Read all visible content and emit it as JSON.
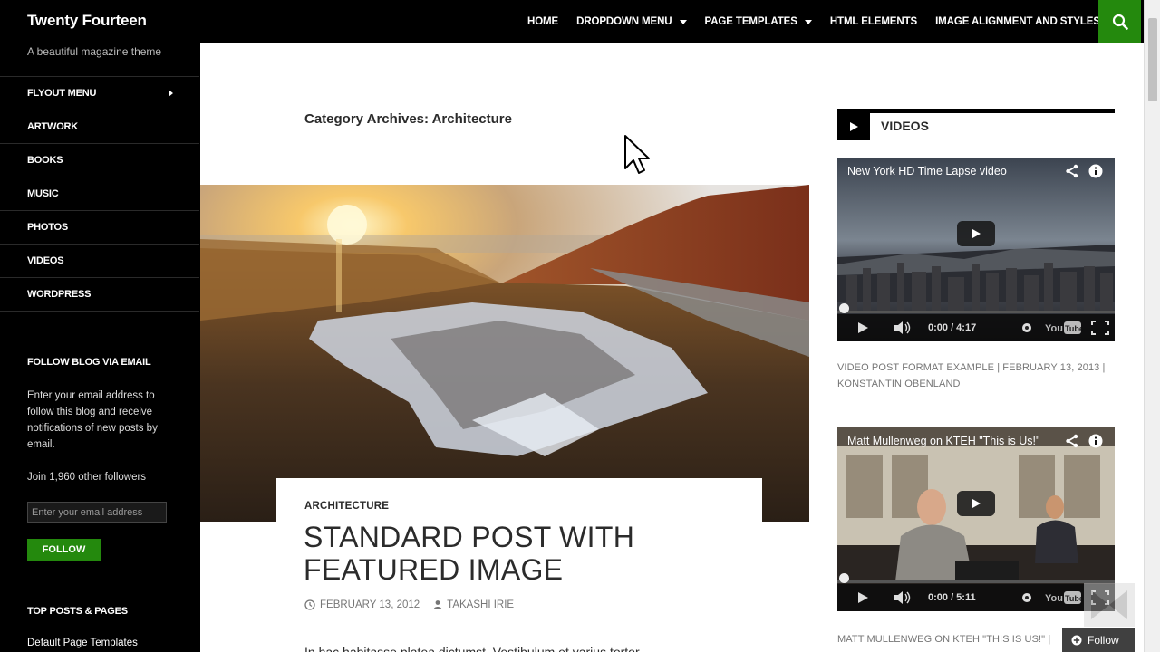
{
  "site": {
    "title": "Twenty Fourteen",
    "tagline": "A beautiful magazine theme"
  },
  "nav": {
    "items": [
      {
        "label": "HOME",
        "has_dropdown": false
      },
      {
        "label": "DROPDOWN MENU",
        "has_dropdown": true
      },
      {
        "label": "PAGE TEMPLATES",
        "has_dropdown": true
      },
      {
        "label": "HTML ELEMENTS",
        "has_dropdown": false
      },
      {
        "label": "IMAGE ALIGNMENT AND STYLES",
        "has_dropdown": false
      }
    ],
    "search_icon": "search-icon"
  },
  "sidebar": {
    "menu": [
      {
        "label": "FLYOUT MENU",
        "has_submenu": true
      },
      {
        "label": "ARTWORK"
      },
      {
        "label": "BOOKS"
      },
      {
        "label": "MUSIC"
      },
      {
        "label": "PHOTOS"
      },
      {
        "label": "VIDEOS"
      },
      {
        "label": "WORDPRESS"
      }
    ],
    "follow_widget": {
      "title": "FOLLOW BLOG VIA EMAIL",
      "description": "Enter your email address to follow this blog and receive notifications of new posts by email.",
      "followers": "Join 1,960 other followers",
      "input_placeholder": "Enter your email address",
      "button_label": "FOLLOW"
    },
    "top_posts": {
      "title": "TOP POSTS & PAGES",
      "first_link": "Default Page Templates"
    }
  },
  "main": {
    "archive_title": "Category Archives: Architecture",
    "post": {
      "category": "ARCHITECTURE",
      "title": "STANDARD POST WITH FEATURED IMAGE",
      "date": "FEBRUARY 13, 2012",
      "author": "TAKASHI IRIE",
      "excerpt": "In hac habitasse platea dictumst. Vestibulum et varius tortor"
    }
  },
  "widget": {
    "title": "VIDEOS",
    "videos": [
      {
        "title": "New York HD Time Lapse video",
        "time": "0:00 / 4:17",
        "meta": "VIDEO POST FORMAT EXAMPLE | FEBRUARY 13, 2013 | KONSTANTIN OBENLAND"
      },
      {
        "title": "Matt Mullenweg on KTEH \"This is Us!\"",
        "time": "0:00 / 5:11",
        "meta": "MATT MULLENWEG ON KTEH \"THIS IS US!\" |"
      }
    ]
  },
  "follow_float": {
    "label": "Follow"
  },
  "colors": {
    "accent": "#24890d",
    "header_bg": "#000000",
    "text": "#2b2b2b",
    "meta": "#767676"
  }
}
